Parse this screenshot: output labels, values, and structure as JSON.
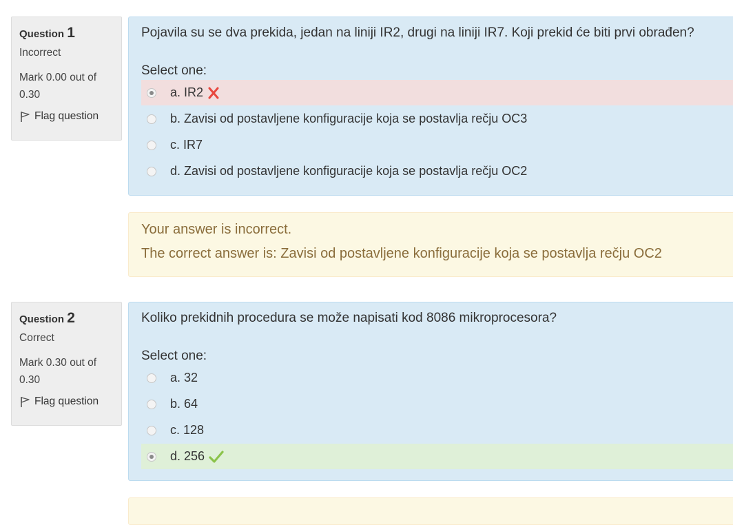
{
  "questions": [
    {
      "label": "Question",
      "number": "1",
      "state": "Incorrect",
      "grade": "Mark 0.00 out of 0.30",
      "flag": "Flag question",
      "text": "Pojavila su se dva prekida, jedan na liniji IR2, drugi na liniji IR7. Koji prekid će biti prvi obrađen?",
      "prompt": "Select one:",
      "options": [
        {
          "label": "a. IR2",
          "selected": true,
          "result": "incorrect"
        },
        {
          "label": "b. Zavisi od postavljene konfiguracije koja se postavlja rečju OC3"
        },
        {
          "label": "c. IR7"
        },
        {
          "label": "d. Zavisi od postavljene konfiguracije koja se postavlja rečju OC2"
        }
      ],
      "feedback": {
        "status": "Your answer is incorrect.",
        "right_answer": "The correct answer is: Zavisi od postavljene konfiguracije koja se postavlja rečju OC2"
      }
    },
    {
      "label": "Question",
      "number": "2",
      "state": "Correct",
      "grade": "Mark 0.30 out of 0.30",
      "flag": "Flag question",
      "text": "Koliko prekidnih procedura se može napisati kod 8086 mikroprocesora?",
      "prompt": "Select one:",
      "options": [
        {
          "label": "a. 32"
        },
        {
          "label": "b. 64"
        },
        {
          "label": "c. 128"
        },
        {
          "label": "d. 256",
          "selected": true,
          "result": "correct"
        }
      ]
    }
  ],
  "colors": {
    "info_bg": "#eeeeee",
    "content_bg": "#d9eaf5",
    "incorrect_bg": "#f2dede",
    "correct_bg": "#dff0d8",
    "feedback_bg": "#fcf8e3",
    "feedback_text": "#8a6d3b",
    "cross_icon": "#e8483f",
    "check_icon": "#8bc34a"
  },
  "icons": {
    "flag": "flag-icon",
    "incorrect": "cross-icon",
    "correct": "check-icon"
  }
}
